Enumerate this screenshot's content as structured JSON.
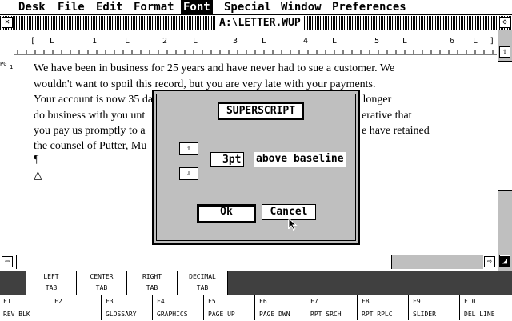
{
  "menubar": {
    "items": [
      "Desk",
      "File",
      "Edit",
      "Format",
      "Font",
      "Special",
      "Window",
      "Preferences"
    ],
    "active": "Font"
  },
  "window": {
    "title": "A:\\LETTER.WUP"
  },
  "ruler": {
    "marks": [
      "[",
      "L",
      "1",
      "L",
      "2",
      "L",
      "3",
      "L",
      "4",
      "L",
      "5",
      "L",
      "6",
      "L",
      "]"
    ]
  },
  "document": {
    "page_label": "PG",
    "page_num": "1",
    "lines": [
      "We have been in business for 25 years and have never had to sue a customer.  We",
      "wouldn't want to spoil this record, but you are very late with your payments.",
      "Your account is now 35 days overdue.  You owe us $2000, and we can no longer",
      "do business with you unt",
      "you pay us promptly to a",
      "the counsel of Putter, Mu"
    ],
    "line4_tail": "erative that",
    "line5_tail": "e have retained",
    "para_mark": "¶",
    "end_mark": "△"
  },
  "dialog": {
    "title": "SUPERSCRIPT",
    "value": "3",
    "unit": "pt",
    "label": "above baseline",
    "ok_label": "Ok",
    "cancel_label": "Cancel"
  },
  "tabs": [
    {
      "l1": "LEFT",
      "l2": "TAB"
    },
    {
      "l1": "CENTER",
      "l2": "TAB"
    },
    {
      "l1": "RIGHT",
      "l2": "TAB"
    },
    {
      "l1": "DECIMAL",
      "l2": "TAB"
    }
  ],
  "fkeys": [
    {
      "num": "F1",
      "name": "REV BLK"
    },
    {
      "num": "F2",
      "name": ""
    },
    {
      "num": "F3",
      "name": "GLOSSARY"
    },
    {
      "num": "F4",
      "name": "GRAPHICS"
    },
    {
      "num": "F5",
      "name": "PAGE UP"
    },
    {
      "num": "F6",
      "name": "PAGE DWN"
    },
    {
      "num": "F7",
      "name": "RPT SRCH"
    },
    {
      "num": "F8",
      "name": "RPT RPLC"
    },
    {
      "num": "F9",
      "name": "SLIDER"
    },
    {
      "num": "F10",
      "name": "DEL LINE"
    }
  ]
}
